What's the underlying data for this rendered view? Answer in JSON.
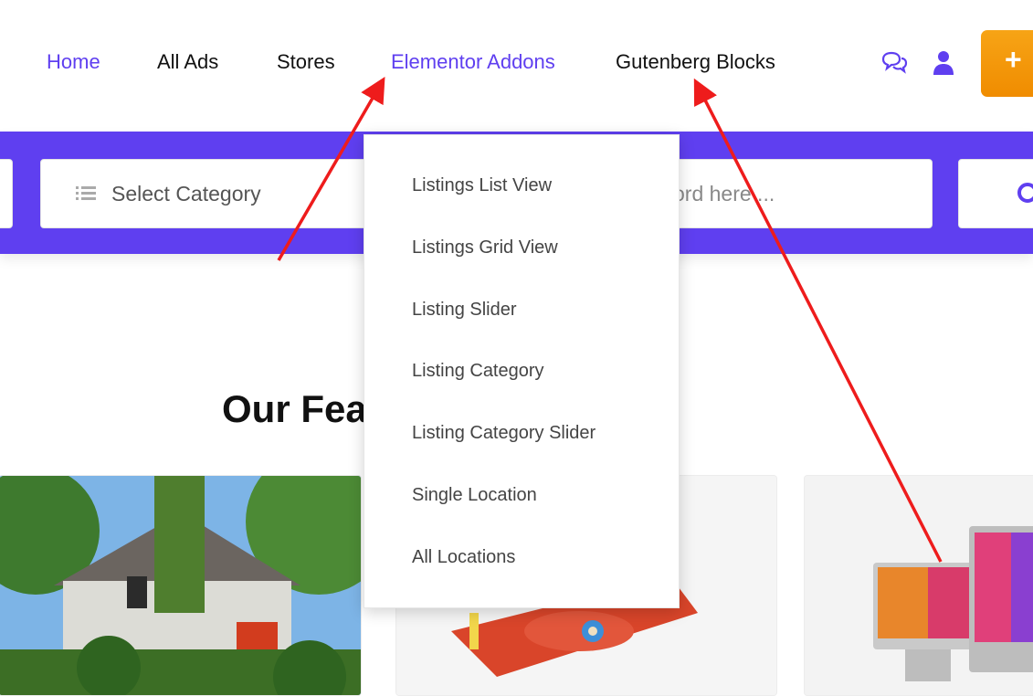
{
  "nav": {
    "items": [
      {
        "label": "Home",
        "active": true
      },
      {
        "label": "All Ads",
        "active": false
      },
      {
        "label": "Stores",
        "active": false
      },
      {
        "label": "Elementor Addons",
        "active": true
      },
      {
        "label": "Gutenberg Blocks",
        "active": false
      }
    ],
    "icons": [
      "chat-icon",
      "user-icon"
    ],
    "post_button_symbol": "+"
  },
  "search": {
    "category_placeholder": "Select Category",
    "keyword_placeholder_visible": "ord here ..."
  },
  "dropdown": {
    "items": [
      "Listings List View",
      "Listings Grid View",
      "Listing Slider",
      "Listing Category",
      "Listing Category Slider",
      "Single Location",
      "All Locations"
    ]
  },
  "section": {
    "title_visible": "Our Fea"
  },
  "colors": {
    "accent": "#5f3ff0",
    "post_button": "#f39c0e",
    "annotation": "#ee1c1c"
  }
}
